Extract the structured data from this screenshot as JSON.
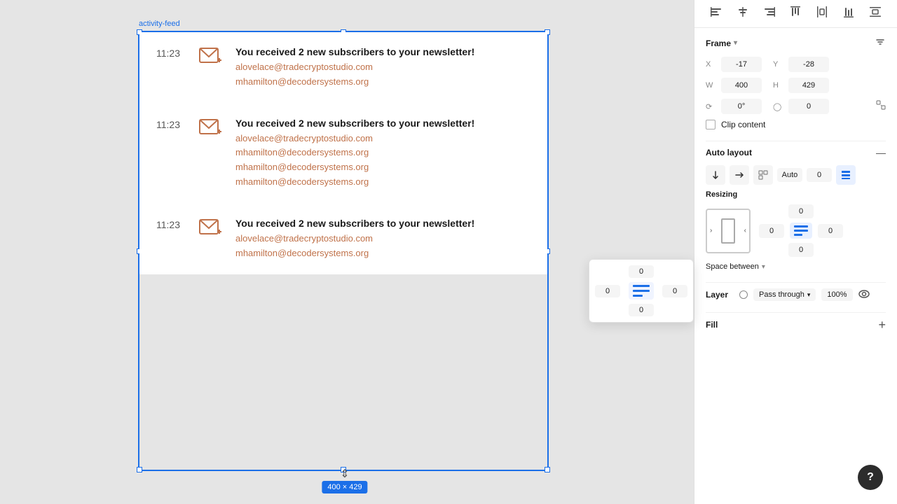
{
  "frame": {
    "label": "activity-feed",
    "x": "-17",
    "y": "-28",
    "w": "400",
    "h": "429",
    "rotation": "0°",
    "corner_radius": "0",
    "size_label": "400 × 429"
  },
  "feed_items": [
    {
      "time": "11:23",
      "title": "You received 2 new subscribers to your newsletter!",
      "emails": [
        "alovelace@tradecryptostudio.com",
        "mhamilton@decodersystems.org"
      ]
    },
    {
      "time": "11:23",
      "title": "You received 2 new subscribers to your newsletter!",
      "emails": [
        "alovelace@tradecryptostudio.com",
        "mhamilton@decodersystems.org",
        "mhamilton@decodersystems.org",
        "mhamilton@decodersystems.org"
      ]
    },
    {
      "time": "11:23",
      "title": "You received 2 new subscribers to your newsletter!",
      "emails": [
        "alovelace@tradecryptostudio.com",
        "mhamilton@decodersystems.org"
      ]
    }
  ],
  "panel": {
    "frame_title": "Frame",
    "x_label": "X",
    "x_value": "-17",
    "y_label": "Y",
    "y_value": "-28",
    "w_label": "W",
    "w_value": "400",
    "h_label": "H",
    "h_value": "429",
    "rotation_value": "0°",
    "corner_value": "0",
    "clip_content_label": "Clip content",
    "autolayout_title": "Auto layout",
    "al_spacing": "Auto",
    "al_num": "0",
    "resizing_title": "Resizing",
    "padding_top": "0",
    "padding_right": "0",
    "padding_bottom": "0",
    "padding_left": "0",
    "space_between_label": "Space between",
    "layer_title": "Layer",
    "pass_through_label": "Pass through",
    "opacity_value": "100%",
    "fill_title": "Fill"
  },
  "toolbar": {
    "icons": [
      "align-left",
      "align-center",
      "align-right",
      "align-top",
      "distribute-h",
      "align-bottom",
      "distribute-v"
    ]
  }
}
